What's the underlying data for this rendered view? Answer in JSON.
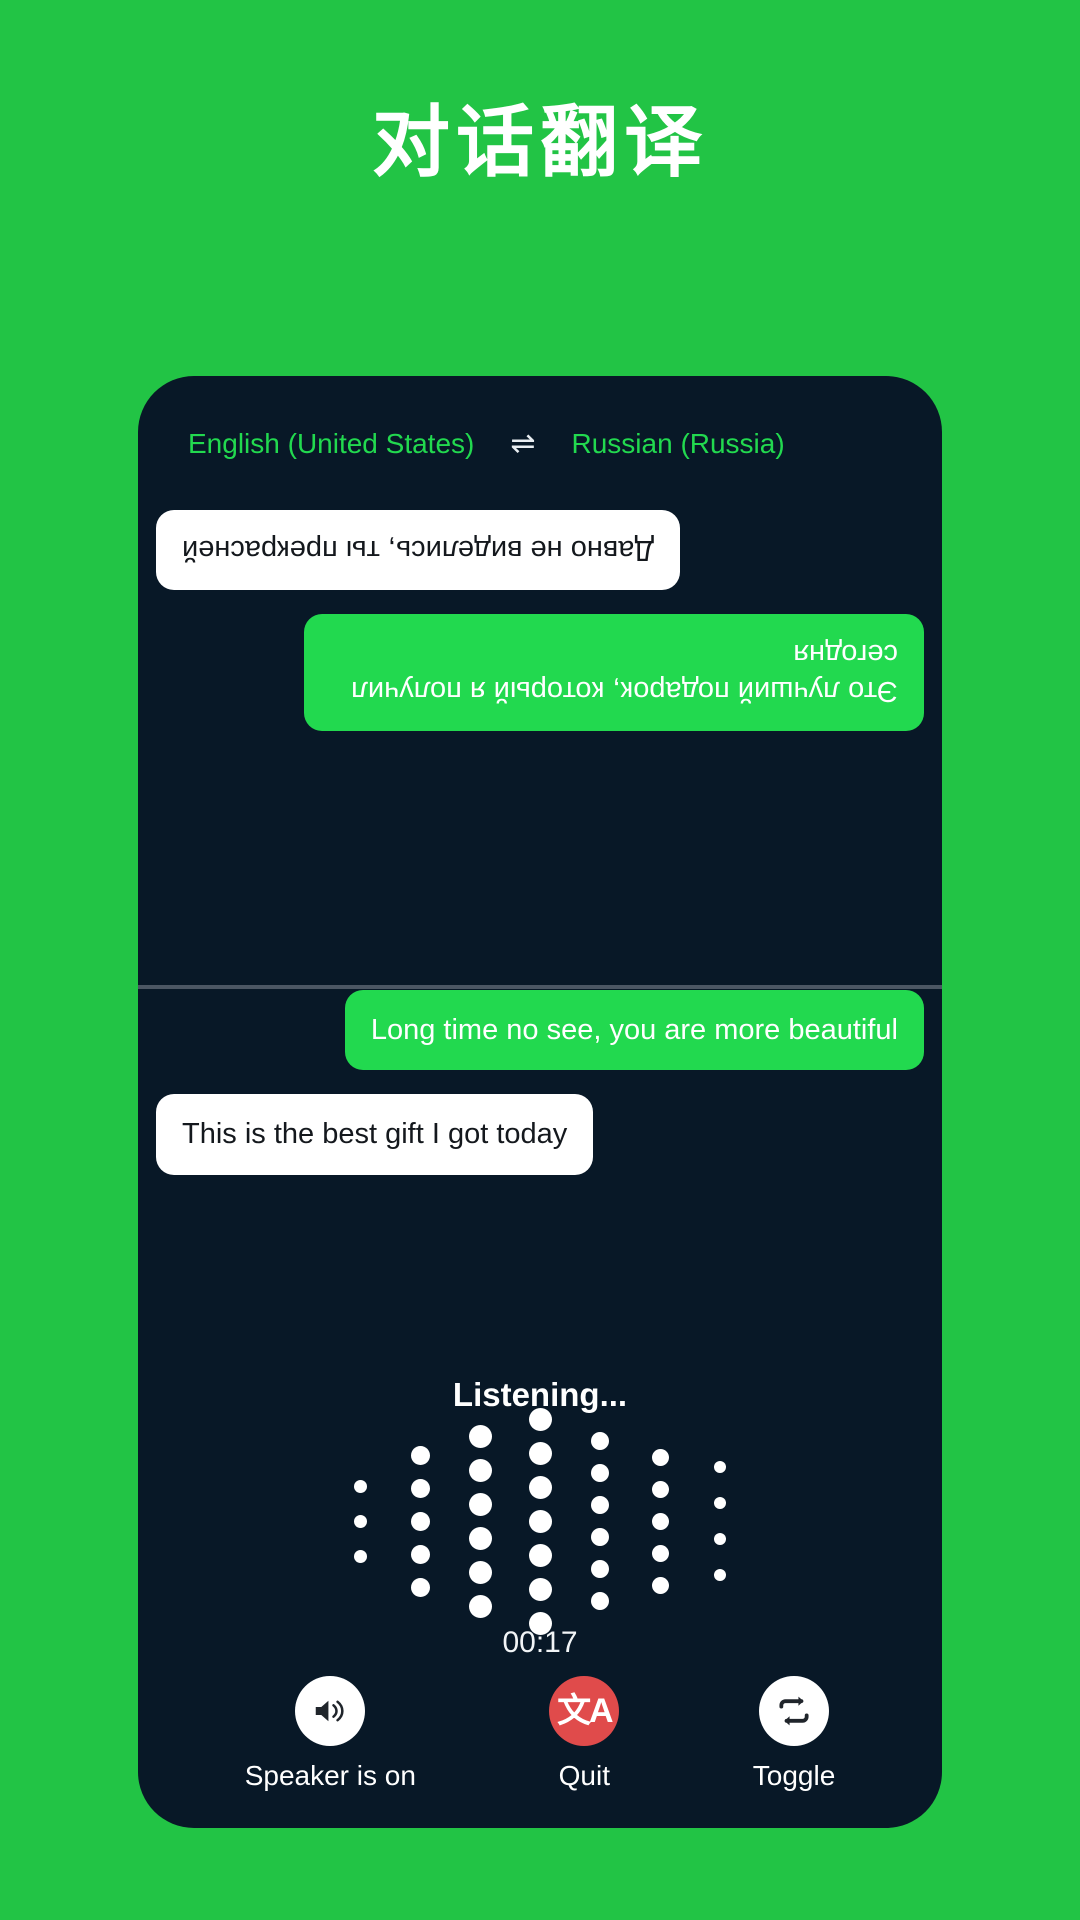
{
  "header": {
    "title": "对话翻译"
  },
  "phone": {
    "language_bar": {
      "source_language": "English (United States)",
      "swap_icon": "⇌",
      "target_language": "Russian (Russia)"
    },
    "translated_pane": {
      "messages": [
        {
          "speaker": "remote",
          "style": "green",
          "text": "Это лучший подарок, который я получил сегодня"
        },
        {
          "speaker": "local",
          "style": "white",
          "text": "Давно не виделись, ты прекрасней"
        }
      ]
    },
    "source_pane": {
      "messages": [
        {
          "speaker": "local",
          "style": "green",
          "text": "Long time no see, you are more beautiful"
        },
        {
          "speaker": "remote",
          "style": "white",
          "text": "This is the best gift I got today"
        }
      ]
    },
    "listening": {
      "status_label": "Listening...",
      "timer": "00:17",
      "visualizer": {
        "dot_color": "#ffffff",
        "columns": [
          {
            "count": 3,
            "dot_size": 13,
            "gap": 22
          },
          {
            "count": 5,
            "dot_size": 19,
            "gap": 14
          },
          {
            "count": 6,
            "dot_size": 23,
            "gap": 11
          },
          {
            "count": 7,
            "dot_size": 23,
            "gap": 11
          },
          {
            "count": 6,
            "dot_size": 18,
            "gap": 14
          },
          {
            "count": 5,
            "dot_size": 17,
            "gap": 15
          },
          {
            "count": 4,
            "dot_size": 12,
            "gap": 24
          }
        ]
      }
    },
    "controls": [
      {
        "name": "speaker",
        "icon": "speaker-on-icon",
        "label": "Speaker is on",
        "circle": "light"
      },
      {
        "name": "quit",
        "icon": "translate-icon",
        "label": "Quit",
        "circle": "red"
      },
      {
        "name": "toggle",
        "icon": "repeat-icon",
        "label": "Toggle",
        "circle": "light"
      }
    ]
  },
  "colors": {
    "brand_green": "#22c445",
    "bubble_green": "#22d94f",
    "phone_bg": "#081827",
    "quit_red": "#e04b4b",
    "divider": "#4b5663"
  }
}
